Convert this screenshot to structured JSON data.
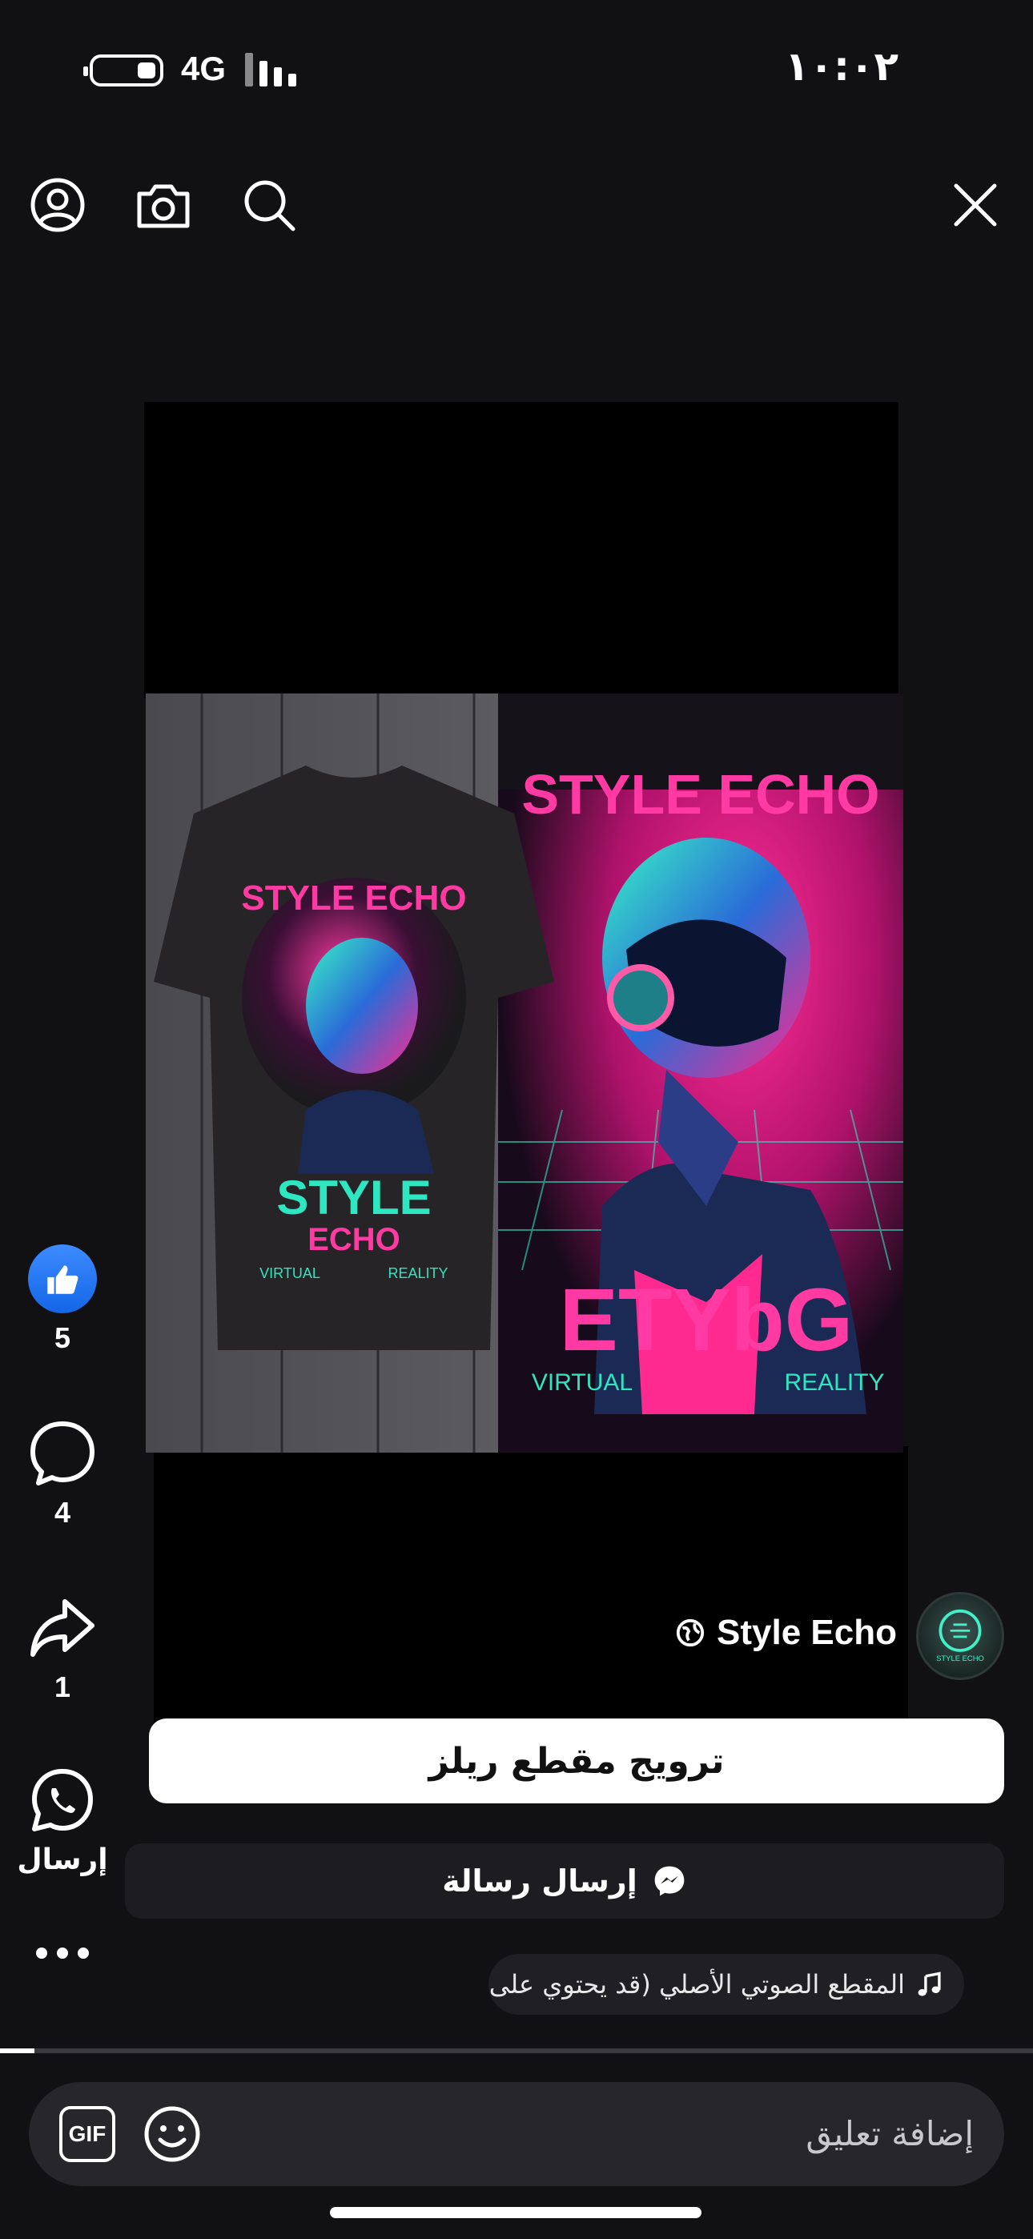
{
  "status_bar": {
    "network": "4G",
    "time": "١٠:٠٢"
  },
  "toolbar": {
    "profile_icon": "person-circle-icon",
    "camera_icon": "camera-icon",
    "search_icon": "search-icon",
    "close_icon": "close-icon"
  },
  "video": {
    "poster_text_top": "STYLE ECHO",
    "poster_text_shirt": "STYLE ECHO",
    "shirt_bottom_text": "STYLE",
    "shirt_bottom_text_2": "ECHO",
    "shirt_tagline_left": "VIRTUAL",
    "shirt_tagline_right": "REALITY",
    "poster_bottom_text": "ETYbG",
    "poster_tagline_left": "VIRTUAL",
    "poster_tagline_right": "REALITY"
  },
  "rail": {
    "like_count": "5",
    "comment_count": "4",
    "share_count": "1",
    "whatsapp_label": "إرسال",
    "colors": {
      "like": "#1877f2"
    }
  },
  "post": {
    "page_name": "Style Echo",
    "avatar_text": "STYLE ECHO",
    "promote_label": "ترويج مقطع ريلز",
    "message_label": "إرسال رسالة",
    "audio_label": "المقطع الصوتي الأصلي (قد يحتوي على"
  },
  "progress": {
    "fraction": 0.033
  },
  "comment": {
    "placeholder": "إضافة تعليق",
    "gif_label": "GIF"
  }
}
